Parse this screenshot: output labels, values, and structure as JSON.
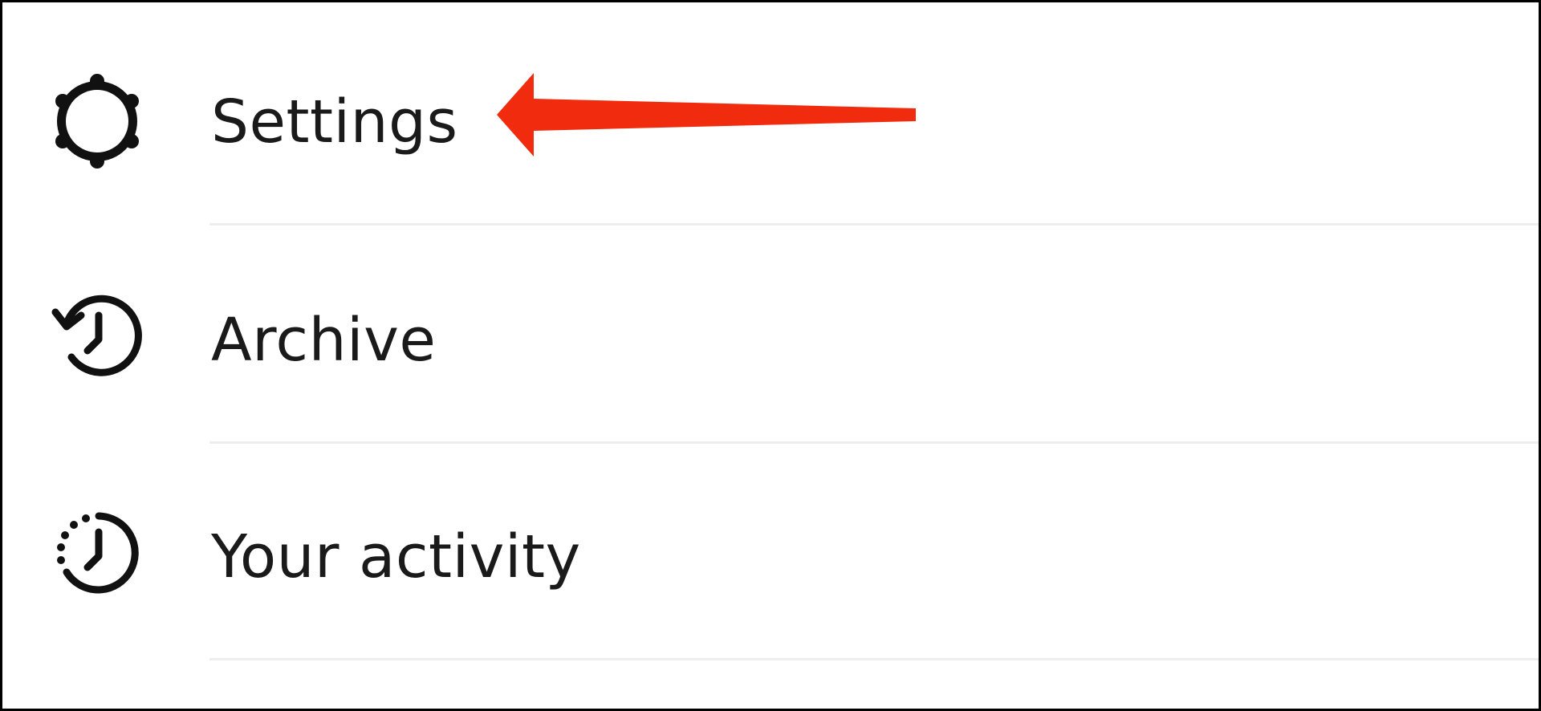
{
  "menu": {
    "items": [
      {
        "label": "Settings",
        "icon": "settings-gear-icon"
      },
      {
        "label": "Archive",
        "icon": "archive-clock-icon"
      },
      {
        "label": "Your activity",
        "icon": "activity-clock-icon"
      }
    ]
  },
  "annotation": {
    "type": "arrow",
    "color": "#f02b0e",
    "points_to": "Settings"
  }
}
